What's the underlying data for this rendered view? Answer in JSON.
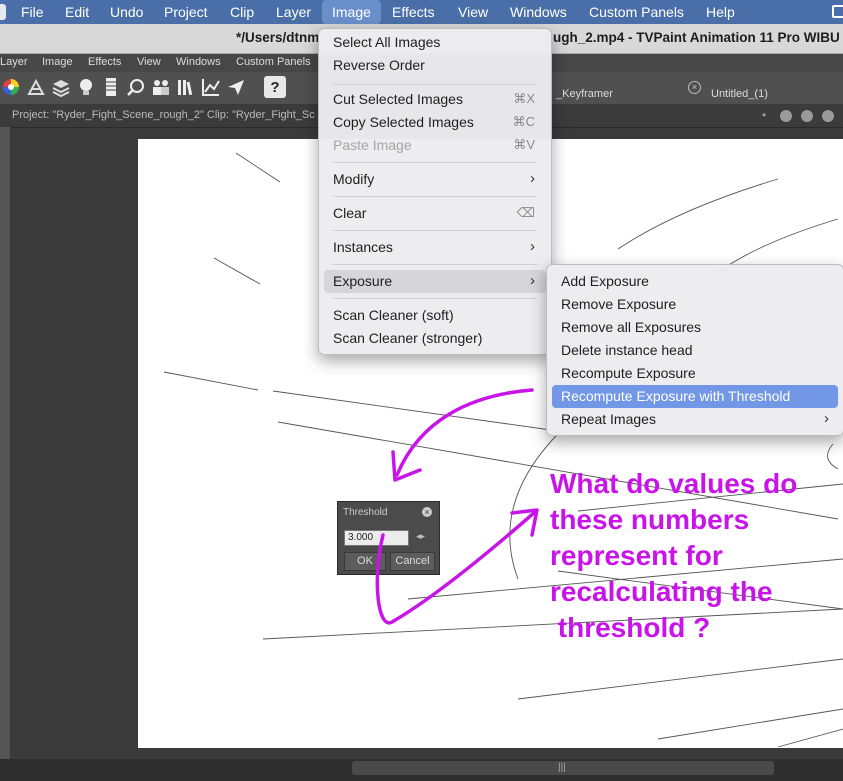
{
  "menubar": {
    "items": [
      "File",
      "Edit",
      "Undo",
      "Project",
      "Clip",
      "Layer",
      "Image",
      "Effects",
      "View",
      "Windows",
      "Custom Panels",
      "Help"
    ],
    "active": "Image"
  },
  "window": {
    "title_left": "*/Users/dtnm",
    "title_right": "ugh_2.mp4 - TVPaint Animation 11 Pro WIBU"
  },
  "app_menu": {
    "items": [
      "Layer",
      "Image",
      "Effects",
      "View",
      "Windows",
      "Custom Panels"
    ]
  },
  "toolbar": {
    "icons": [
      "color-wheel-icon",
      "tools-icon",
      "layers-icon",
      "lightbulb-icon",
      "piano-icon",
      "magnify-icon",
      "people-icon",
      "library-icon",
      "chart-icon",
      "paper-plane-icon",
      "help-icon"
    ],
    "help_glyph": "?"
  },
  "tabs": [
    {
      "label": "_Keyframer"
    },
    {
      "label": "Untitled_(1)"
    }
  ],
  "infobar": {
    "text": "Project:  \"Ryder_Fight_Scene_rough_2\"  Clip: \"Ryder_Fight_Sc"
  },
  "image_menu": {
    "groups": [
      [
        {
          "label": "Select All Images"
        },
        {
          "label": "Reverse Order"
        }
      ],
      [
        {
          "label": "Cut Selected Images",
          "shortcut": "⌘X"
        },
        {
          "label": "Copy Selected Images",
          "shortcut": "⌘C"
        },
        {
          "label": "Paste Image",
          "shortcut": "⌘V",
          "disabled": true
        }
      ],
      [
        {
          "label": "Modify",
          "submenu": true
        }
      ],
      [
        {
          "label": "Clear",
          "shortcut": "⌫"
        }
      ],
      [
        {
          "label": "Instances",
          "submenu": true
        }
      ],
      [
        {
          "label": "Exposure",
          "submenu": true,
          "highlighted": true
        }
      ],
      [
        {
          "label": "Scan Cleaner (soft)"
        },
        {
          "label": "Scan Cleaner (stronger)"
        }
      ]
    ]
  },
  "exposure_submenu": {
    "items": [
      {
        "label": "Add Exposure"
      },
      {
        "label": "Remove Exposure"
      },
      {
        "label": "Remove all Exposures"
      },
      {
        "label": "Delete instance head"
      },
      {
        "label": "Recompute Exposure"
      },
      {
        "label": "Recompute Exposure with Threshold",
        "selected": true
      },
      {
        "label": "Repeat Images",
        "submenu": true
      }
    ]
  },
  "threshold_dialog": {
    "title": "Threshold",
    "value": "3.000",
    "ok_label": "OK",
    "cancel_label": "Cancel"
  },
  "annotation": {
    "lines": [
      "What do values do",
      "these numbers",
      "represent for",
      "recalculating the",
      " threshold ?"
    ],
    "color": "#c814e8"
  },
  "colors": {
    "menubar": "#4a6fa8",
    "menubar_active": "#6b8fc9",
    "submenu_selected": "#7297e6"
  }
}
